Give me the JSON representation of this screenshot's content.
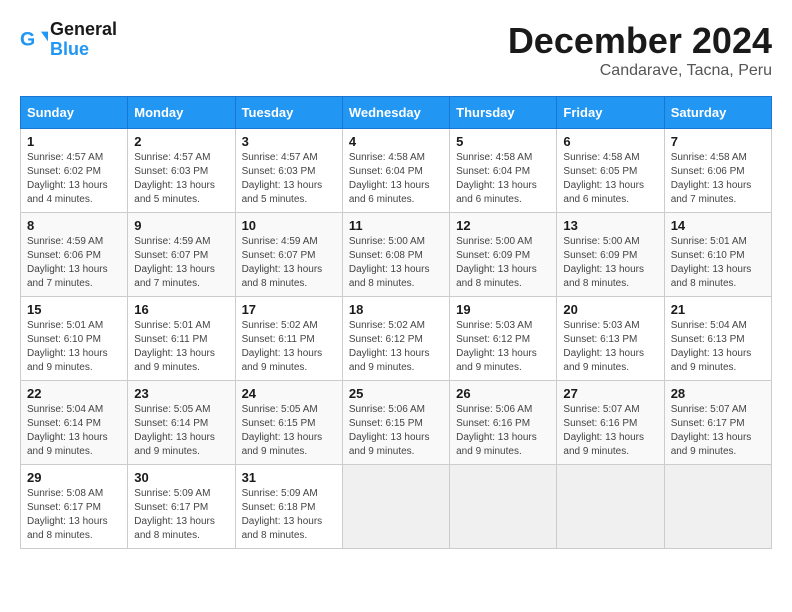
{
  "logo": {
    "text_general": "General",
    "text_blue": "Blue"
  },
  "title": "December 2024",
  "subtitle": "Candarave, Tacna, Peru",
  "days_of_week": [
    "Sunday",
    "Monday",
    "Tuesday",
    "Wednesday",
    "Thursday",
    "Friday",
    "Saturday"
  ],
  "weeks": [
    [
      {
        "day": "1",
        "sunrise": "4:57 AM",
        "sunset": "6:02 PM",
        "daylight": "13 hours and 4 minutes."
      },
      {
        "day": "2",
        "sunrise": "4:57 AM",
        "sunset": "6:03 PM",
        "daylight": "13 hours and 5 minutes."
      },
      {
        "day": "3",
        "sunrise": "4:57 AM",
        "sunset": "6:03 PM",
        "daylight": "13 hours and 5 minutes."
      },
      {
        "day": "4",
        "sunrise": "4:58 AM",
        "sunset": "6:04 PM",
        "daylight": "13 hours and 6 minutes."
      },
      {
        "day": "5",
        "sunrise": "4:58 AM",
        "sunset": "6:04 PM",
        "daylight": "13 hours and 6 minutes."
      },
      {
        "day": "6",
        "sunrise": "4:58 AM",
        "sunset": "6:05 PM",
        "daylight": "13 hours and 6 minutes."
      },
      {
        "day": "7",
        "sunrise": "4:58 AM",
        "sunset": "6:06 PM",
        "daylight": "13 hours and 7 minutes."
      }
    ],
    [
      {
        "day": "8",
        "sunrise": "4:59 AM",
        "sunset": "6:06 PM",
        "daylight": "13 hours and 7 minutes."
      },
      {
        "day": "9",
        "sunrise": "4:59 AM",
        "sunset": "6:07 PM",
        "daylight": "13 hours and 7 minutes."
      },
      {
        "day": "10",
        "sunrise": "4:59 AM",
        "sunset": "6:07 PM",
        "daylight": "13 hours and 8 minutes."
      },
      {
        "day": "11",
        "sunrise": "5:00 AM",
        "sunset": "6:08 PM",
        "daylight": "13 hours and 8 minutes."
      },
      {
        "day": "12",
        "sunrise": "5:00 AM",
        "sunset": "6:09 PM",
        "daylight": "13 hours and 8 minutes."
      },
      {
        "day": "13",
        "sunrise": "5:00 AM",
        "sunset": "6:09 PM",
        "daylight": "13 hours and 8 minutes."
      },
      {
        "day": "14",
        "sunrise": "5:01 AM",
        "sunset": "6:10 PM",
        "daylight": "13 hours and 8 minutes."
      }
    ],
    [
      {
        "day": "15",
        "sunrise": "5:01 AM",
        "sunset": "6:10 PM",
        "daylight": "13 hours and 9 minutes."
      },
      {
        "day": "16",
        "sunrise": "5:01 AM",
        "sunset": "6:11 PM",
        "daylight": "13 hours and 9 minutes."
      },
      {
        "day": "17",
        "sunrise": "5:02 AM",
        "sunset": "6:11 PM",
        "daylight": "13 hours and 9 minutes."
      },
      {
        "day": "18",
        "sunrise": "5:02 AM",
        "sunset": "6:12 PM",
        "daylight": "13 hours and 9 minutes."
      },
      {
        "day": "19",
        "sunrise": "5:03 AM",
        "sunset": "6:12 PM",
        "daylight": "13 hours and 9 minutes."
      },
      {
        "day": "20",
        "sunrise": "5:03 AM",
        "sunset": "6:13 PM",
        "daylight": "13 hours and 9 minutes."
      },
      {
        "day": "21",
        "sunrise": "5:04 AM",
        "sunset": "6:13 PM",
        "daylight": "13 hours and 9 minutes."
      }
    ],
    [
      {
        "day": "22",
        "sunrise": "5:04 AM",
        "sunset": "6:14 PM",
        "daylight": "13 hours and 9 minutes."
      },
      {
        "day": "23",
        "sunrise": "5:05 AM",
        "sunset": "6:14 PM",
        "daylight": "13 hours and 9 minutes."
      },
      {
        "day": "24",
        "sunrise": "5:05 AM",
        "sunset": "6:15 PM",
        "daylight": "13 hours and 9 minutes."
      },
      {
        "day": "25",
        "sunrise": "5:06 AM",
        "sunset": "6:15 PM",
        "daylight": "13 hours and 9 minutes."
      },
      {
        "day": "26",
        "sunrise": "5:06 AM",
        "sunset": "6:16 PM",
        "daylight": "13 hours and 9 minutes."
      },
      {
        "day": "27",
        "sunrise": "5:07 AM",
        "sunset": "6:16 PM",
        "daylight": "13 hours and 9 minutes."
      },
      {
        "day": "28",
        "sunrise": "5:07 AM",
        "sunset": "6:17 PM",
        "daylight": "13 hours and 9 minutes."
      }
    ],
    [
      {
        "day": "29",
        "sunrise": "5:08 AM",
        "sunset": "6:17 PM",
        "daylight": "13 hours and 8 minutes."
      },
      {
        "day": "30",
        "sunrise": "5:09 AM",
        "sunset": "6:17 PM",
        "daylight": "13 hours and 8 minutes."
      },
      {
        "day": "31",
        "sunrise": "5:09 AM",
        "sunset": "6:18 PM",
        "daylight": "13 hours and 8 minutes."
      },
      null,
      null,
      null,
      null
    ]
  ]
}
